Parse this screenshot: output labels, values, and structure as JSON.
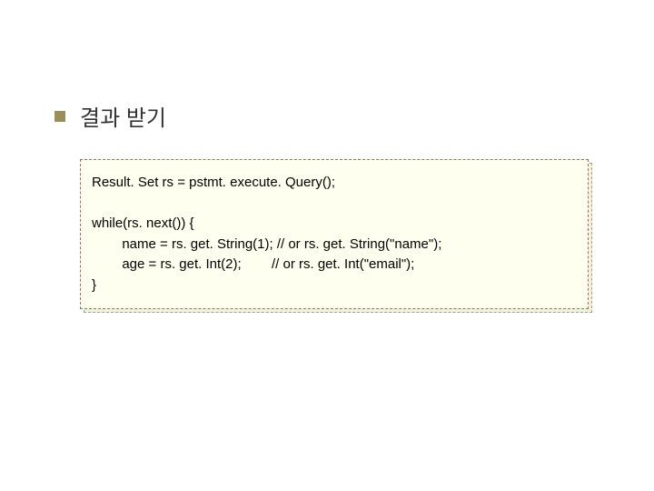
{
  "heading": "결과 받기",
  "code": {
    "l1": "Result. Set rs = pstmt. execute. Query();",
    "l2": "while(rs. next()) {",
    "l3": "        name = rs. get. String(1); // or rs. get. String(\"name\");",
    "l4": "        age = rs. get. Int(2);        // or rs. get. Int(\"email\");",
    "l5": "}"
  }
}
